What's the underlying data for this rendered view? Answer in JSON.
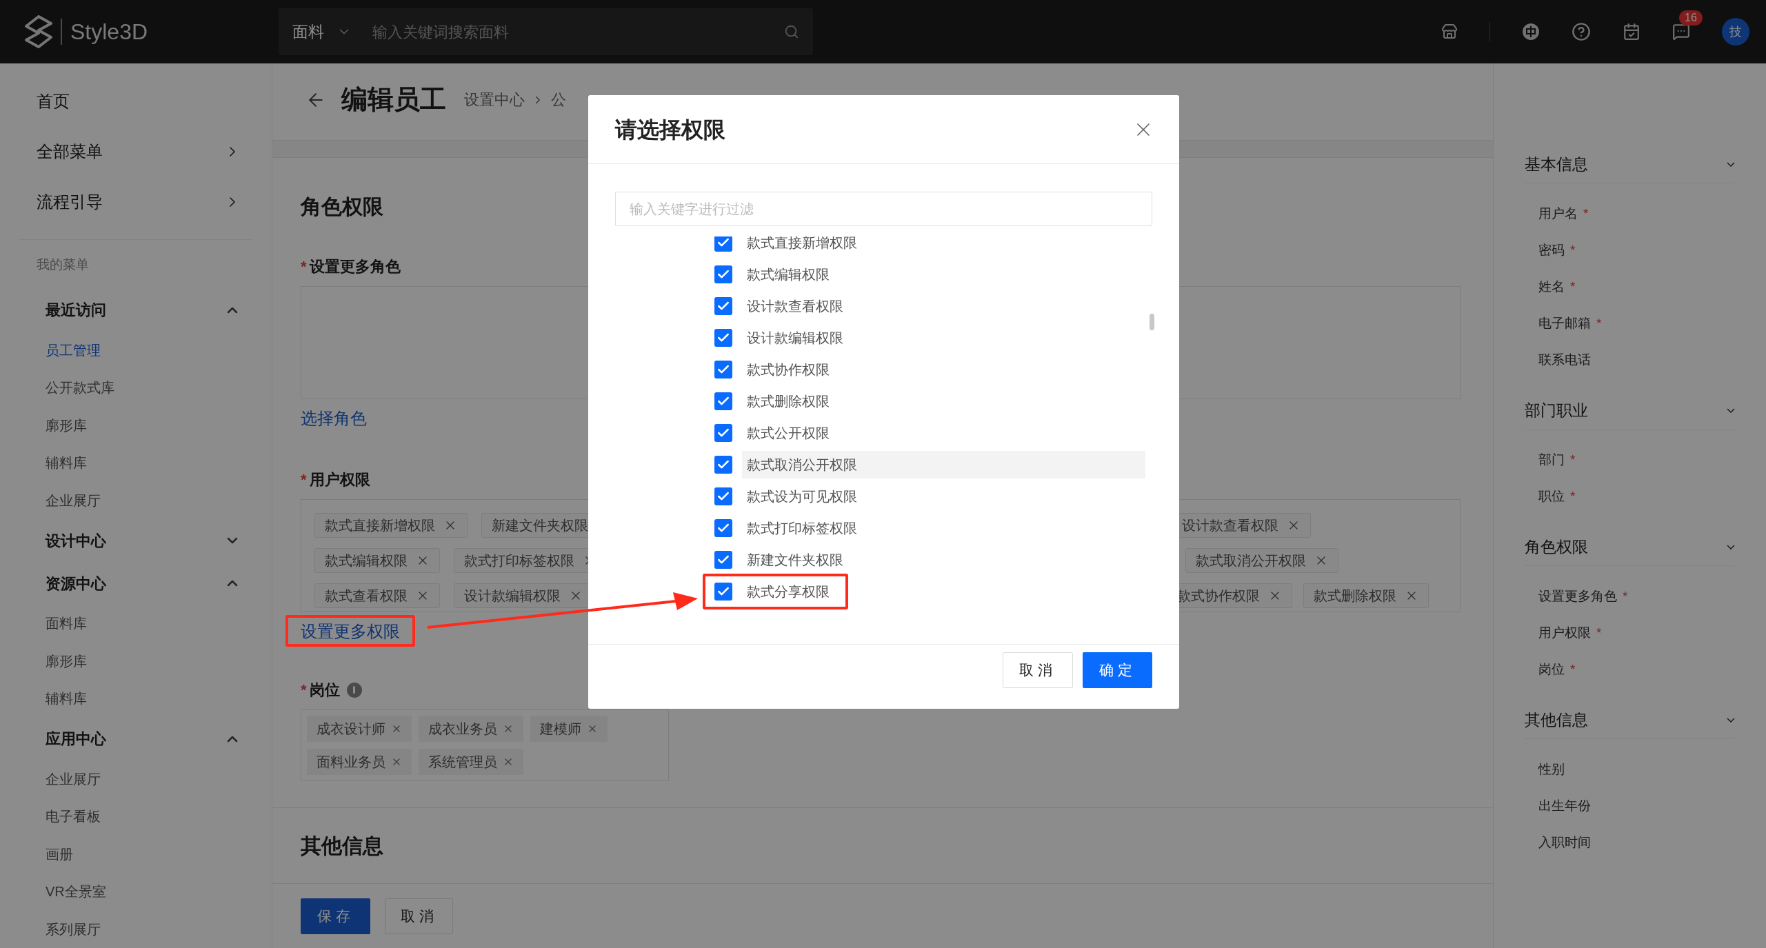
{
  "header": {
    "logo": "Style3D",
    "search_category": "面料",
    "search_placeholder": "输入关键词搜索面料",
    "notification_count": "16",
    "avatar": "技"
  },
  "sidebar": {
    "top_items": [
      {
        "label": "首页",
        "expandable": false
      },
      {
        "label": "全部菜单",
        "expandable": true
      },
      {
        "label": "流程引导",
        "expandable": true
      }
    ],
    "section_label": "我的菜单",
    "groups": [
      {
        "label": "最近访问",
        "expanded": true,
        "children": [
          {
            "label": "员工管理",
            "selected": true
          },
          {
            "label": "公开款式库",
            "selected": false
          },
          {
            "label": "廓形库",
            "selected": false
          },
          {
            "label": "辅料库",
            "selected": false
          },
          {
            "label": "企业展厅",
            "selected": false
          }
        ]
      },
      {
        "label": "设计中心",
        "expanded": false
      },
      {
        "label": "资源中心",
        "expanded": true,
        "children": [
          {
            "label": "面料库",
            "selected": false
          },
          {
            "label": "廓形库",
            "selected": false
          },
          {
            "label": "辅料库",
            "selected": false
          }
        ]
      },
      {
        "label": "应用中心",
        "expanded": true,
        "children": [
          {
            "label": "企业展厅",
            "selected": false
          },
          {
            "label": "电子看板",
            "selected": false
          },
          {
            "label": "画册",
            "selected": false
          },
          {
            "label": "VR全景室",
            "selected": false
          },
          {
            "label": "系列展厅",
            "selected": false
          }
        ]
      }
    ]
  },
  "page": {
    "title": "编辑员工",
    "breadcrumb": [
      "设置中心",
      "公"
    ],
    "role_section": {
      "title": "角色权限",
      "roles_field": {
        "label": "设置更多角色",
        "required_mark": "*"
      },
      "select_role_link": "选择角色",
      "permissions_field": {
        "label": "用户权限",
        "required_mark": "*"
      },
      "permission_tag_rows": [
        {
          "left": [
            {
              "label": "款式直接新增权限",
              "closable": true
            },
            {
              "label": "新建文件夹权限",
              "closable": false
            }
          ],
          "right": [
            {
              "label": "设计款查看权限",
              "closable": true
            }
          ]
        },
        {
          "left": [
            {
              "label": "款式编辑权限",
              "closable": true
            },
            {
              "label": "款式打印标签权限",
              "closable": true
            }
          ],
          "right": [
            {
              "label": "款式取消公开权限",
              "closable": true
            }
          ]
        },
        {
          "left": [
            {
              "label": "款式查看权限",
              "closable": true
            },
            {
              "label": "设计款编辑权限",
              "closable": true
            }
          ],
          "right": [
            {
              "label": "款式协作权限",
              "closable": true
            },
            {
              "label": "款式删除权限",
              "closable": true
            }
          ]
        }
      ],
      "more_permissions_link": "设置更多权限",
      "position_field": {
        "label": "岗位",
        "required_mark": "*"
      },
      "position_tags": [
        "成衣设计师",
        "成衣业务员",
        "建模师",
        "面料业务员",
        "系统管理员"
      ]
    },
    "other_section": {
      "title": "其他信息"
    },
    "actions": {
      "save": "保存",
      "cancel": "取消"
    }
  },
  "outline": [
    {
      "title": "基本信息",
      "items": [
        {
          "label": "用户名",
          "required_mark": "*"
        },
        {
          "label": "密码",
          "required_mark": "*"
        },
        {
          "label": "姓名",
          "required_mark": "*"
        },
        {
          "label": "电子邮箱",
          "required_mark": "*"
        },
        {
          "label": "联系电话"
        }
      ]
    },
    {
      "title": "部门职业",
      "items": [
        {
          "label": "部门",
          "required_mark": "*"
        },
        {
          "label": "职位",
          "required_mark": "*"
        }
      ]
    },
    {
      "title": "角色权限",
      "items": [
        {
          "label": "设置更多角色",
          "required_mark": "*"
        },
        {
          "label": "用户权限",
          "required_mark": "*"
        },
        {
          "label": "岗位",
          "required_mark": "*"
        }
      ]
    },
    {
      "title": "其他信息",
      "items": [
        {
          "label": "性别"
        },
        {
          "label": "出生年份"
        },
        {
          "label": "入职时间"
        }
      ]
    }
  ],
  "dialog": {
    "title": "请选择权限",
    "filter_placeholder": "输入关键字进行过滤",
    "options": [
      {
        "label": "款式直接新增权限",
        "checked": true,
        "hovered": false,
        "annotated": false
      },
      {
        "label": "款式编辑权限",
        "checked": true,
        "hovered": false,
        "annotated": false
      },
      {
        "label": "设计款查看权限",
        "checked": true,
        "hovered": false,
        "annotated": false
      },
      {
        "label": "设计款编辑权限",
        "checked": true,
        "hovered": false,
        "annotated": false
      },
      {
        "label": "款式协作权限",
        "checked": true,
        "hovered": false,
        "annotated": false
      },
      {
        "label": "款式删除权限",
        "checked": true,
        "hovered": false,
        "annotated": false
      },
      {
        "label": "款式公开权限",
        "checked": true,
        "hovered": false,
        "annotated": false
      },
      {
        "label": "款式取消公开权限",
        "checked": true,
        "hovered": true,
        "annotated": false
      },
      {
        "label": "款式设为可见权限",
        "checked": true,
        "hovered": false,
        "annotated": false
      },
      {
        "label": "款式打印标签权限",
        "checked": true,
        "hovered": false,
        "annotated": false
      },
      {
        "label": "新建文件夹权限",
        "checked": true,
        "hovered": false,
        "annotated": false
      },
      {
        "label": "款式分享权限",
        "checked": true,
        "hovered": false,
        "annotated": true
      }
    ],
    "cancel": "取消",
    "confirm": "确定"
  }
}
